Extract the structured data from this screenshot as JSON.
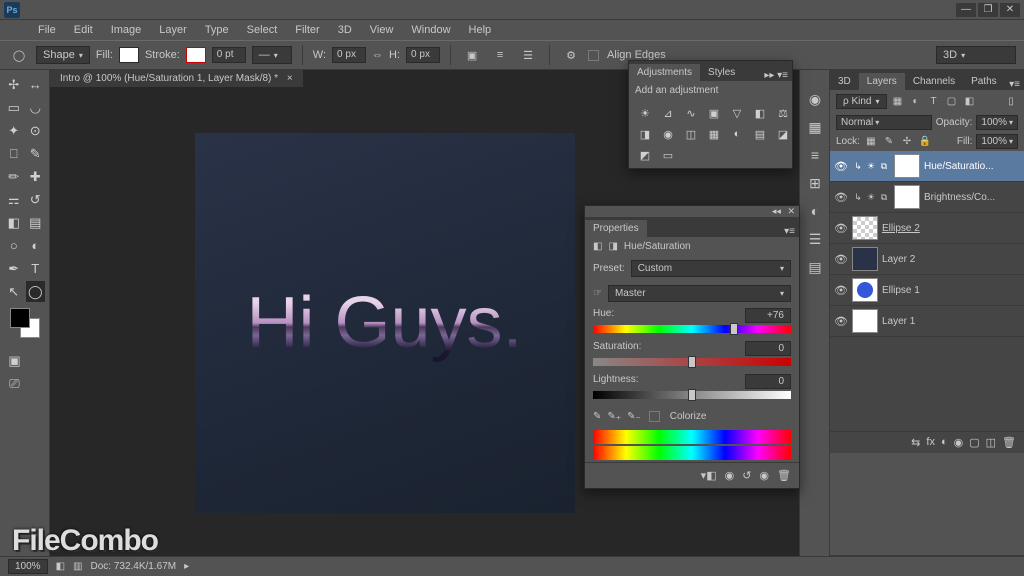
{
  "app": {
    "logo": "Ps"
  },
  "window": {
    "minimize": "—",
    "restore": "❐",
    "close": "✕"
  },
  "menus": [
    "File",
    "Edit",
    "Image",
    "Layer",
    "Type",
    "Select",
    "Filter",
    "3D",
    "View",
    "Window",
    "Help"
  ],
  "options": {
    "tool_mode": "Shape",
    "fill_label": "Fill:",
    "stroke_label": "Stroke:",
    "stroke_width": "0 pt",
    "w_label": "W:",
    "w_val": "0 px",
    "h_label": "H:",
    "h_val": "0 px",
    "align_edges": "Align Edges",
    "workspace": "3D"
  },
  "document": {
    "tab_title": "Intro @ 100% (Hue/Saturation 1, Layer Mask/8) *",
    "canvas_text": "Hi Guys."
  },
  "adjustments": {
    "tab_adjustments": "Adjustments",
    "tab_styles": "Styles",
    "heading": "Add an adjustment"
  },
  "properties": {
    "tab": "Properties",
    "title": "Hue/Saturation",
    "preset_label": "Preset:",
    "preset_value": "Custom",
    "channel_value": "Master",
    "hue_label": "Hue:",
    "hue_value": "+76",
    "sat_label": "Saturation:",
    "sat_value": "0",
    "light_label": "Lightness:",
    "light_value": "0",
    "colorize_label": "Colorize"
  },
  "layers_panel": {
    "tabs": [
      "3D",
      "Layers",
      "Channels",
      "Paths"
    ],
    "active_tab": 1,
    "filter_kind": "ρ Kind",
    "blend_mode": "Normal",
    "opacity_label": "Opacity:",
    "opacity_value": "100%",
    "lock_label": "Lock:",
    "fill_label": "Fill:",
    "fill_value": "100%",
    "layers": [
      {
        "name": "Hue/Saturatio...",
        "type": "adj",
        "selected": true,
        "linked": true
      },
      {
        "name": "Brightness/Co...",
        "type": "adj",
        "selected": false,
        "linked": true
      },
      {
        "name": "Ellipse 2",
        "type": "check",
        "selected": false,
        "underline": true
      },
      {
        "name": "Layer 2",
        "type": "dark",
        "selected": false
      },
      {
        "name": "Ellipse 1",
        "type": "ellipse",
        "selected": false
      },
      {
        "name": "Layer 1",
        "type": "white",
        "selected": false
      }
    ]
  },
  "status": {
    "zoom": "100%",
    "doc_info": "Doc: 732.4K/1.67M"
  },
  "watermark": "FileCombo"
}
